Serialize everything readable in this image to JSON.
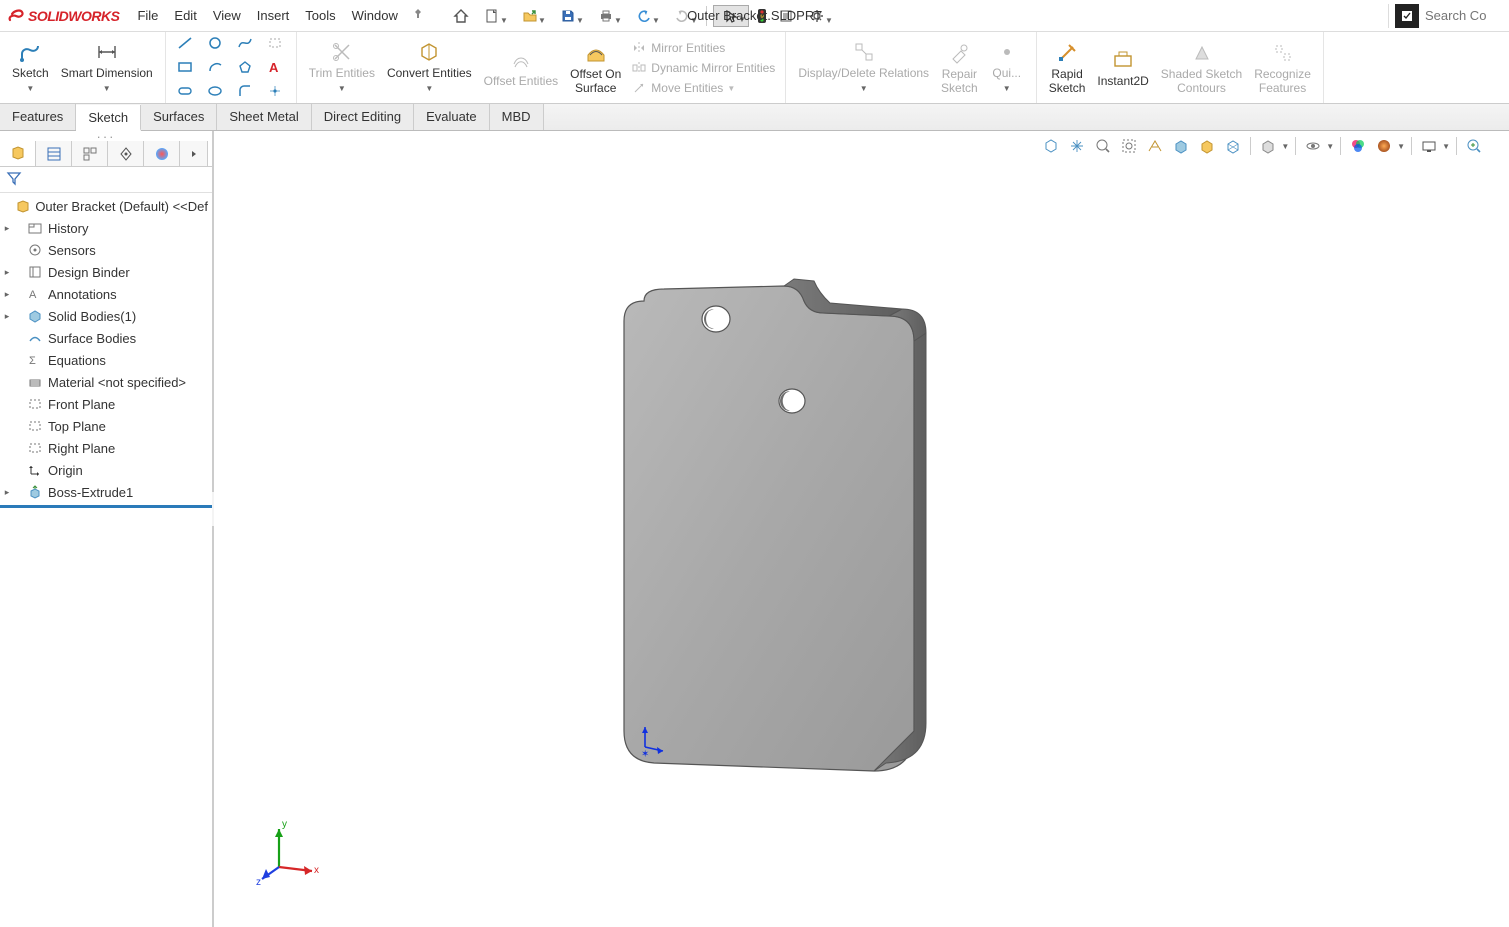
{
  "app": {
    "name": "SOLIDWORKS",
    "documentTitle": "Outer Bracket.SLDPRT"
  },
  "menu": {
    "file": "File",
    "edit": "Edit",
    "view": "View",
    "insert": "Insert",
    "tools": "Tools",
    "window": "Window"
  },
  "search": {
    "placeholder": "Search Co"
  },
  "ribbon": {
    "sketch": "Sketch",
    "smartDim": "Smart Dimension",
    "trim": "Trim Entities",
    "convert": "Convert Entities",
    "offset": "Offset Entities",
    "offsetSurf1": "Offset On",
    "offsetSurf2": "Surface",
    "mirror": "Mirror Entities",
    "dynMirror": "Dynamic Mirror Entities",
    "move": "Move Entities",
    "dispRel": "Display/Delete Relations",
    "repair1": "Repair",
    "repair2": "Sketch",
    "quick": "Qui...",
    "rapid1": "Rapid",
    "rapid2": "Sketch",
    "instant2d": "Instant2D",
    "shaded1": "Shaded Sketch",
    "shaded2": "Contours",
    "recog1": "Recognize",
    "recog2": "Features"
  },
  "tabs": {
    "features": "Features",
    "sketch": "Sketch",
    "surfaces": "Surfaces",
    "sheetmetal": "Sheet Metal",
    "directEdit": "Direct Editing",
    "evaluate": "Evaluate",
    "mbd": "MBD"
  },
  "tree": {
    "root": "Outer Bracket (Default) <<Def",
    "history": "History",
    "sensors": "Sensors",
    "designBinder": "Design Binder",
    "annotations": "Annotations",
    "solidBodies": "Solid Bodies(1)",
    "surfaceBodies": "Surface Bodies",
    "equations": "Equations",
    "material": "Material <not specified>",
    "frontPlane": "Front Plane",
    "topPlane": "Top Plane",
    "rightPlane": "Right Plane",
    "origin": "Origin",
    "bossExtrude": "Boss-Extrude1"
  },
  "triad": {
    "x": "x",
    "y": "y",
    "z": "z"
  }
}
